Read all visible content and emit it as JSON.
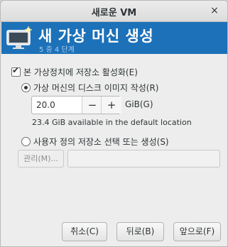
{
  "window": {
    "title": "새로운 VM",
    "close_symbol": "×"
  },
  "banner": {
    "heading": "새 가상 머신 생성",
    "step": "5 중 4 단계",
    "icon": "monitor-sparkle-icon",
    "color": "#1d71b8"
  },
  "storage": {
    "enable_label": "본 가상정치에 저장소 활성화(E)",
    "enable_checked": true,
    "create_disk_label": "가상 머신의 디스크 이미지 작성(R)",
    "create_disk_selected": true,
    "size_value": "20.0",
    "decrement": "−",
    "increment": "+",
    "unit": "GiB(G)",
    "available": "23.4 GiB available in the default location",
    "custom_label": "사용자 정의 저장소 선택 또는 생성(S)",
    "custom_selected": false,
    "manage_label": "관리(M)...",
    "path_value": ""
  },
  "footer": {
    "cancel": "취소(C)",
    "back": "뒤로(B)",
    "forward": "앞으로(F)"
  }
}
